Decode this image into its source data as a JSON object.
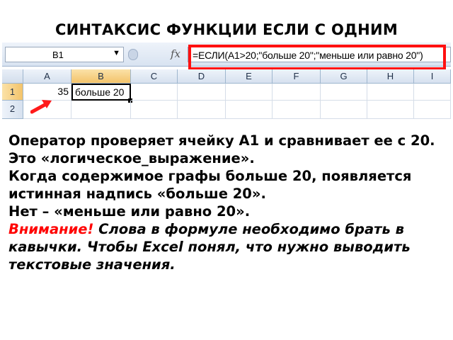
{
  "slide": {
    "title": "СИНТАКСИС ФУНКЦИИ ЕСЛИ С ОДНИМ"
  },
  "excel": {
    "name_box": "B1",
    "fx_icon": "fx-icon",
    "formula": "=ЕСЛИ(A1>20;\"больше 20\";\"меньше или равно 20\")",
    "columns": [
      "A",
      "B",
      "C",
      "D",
      "E",
      "F",
      "G",
      "H",
      "I"
    ],
    "rows": [
      "1",
      "2"
    ],
    "cells": {
      "A1": "35",
      "B1": "больше 20"
    },
    "highlight_color": "#ff1010"
  },
  "text": {
    "line1": "Оператор проверяет ячейку А1 и сравнивает ее с 20.",
    "line2": "Это «логическое_выражение».",
    "line3": "Когда содержимое графы больше 20, появляется истинная надпись «больше 20».",
    "line4": "Нет – «меньше или равно 20».",
    "warning_label": "Внимание!",
    "warning_text": " Слова в формуле необходимо брать в кавычки. Чтобы Excel понял, что нужно выводить текстовые значения."
  }
}
